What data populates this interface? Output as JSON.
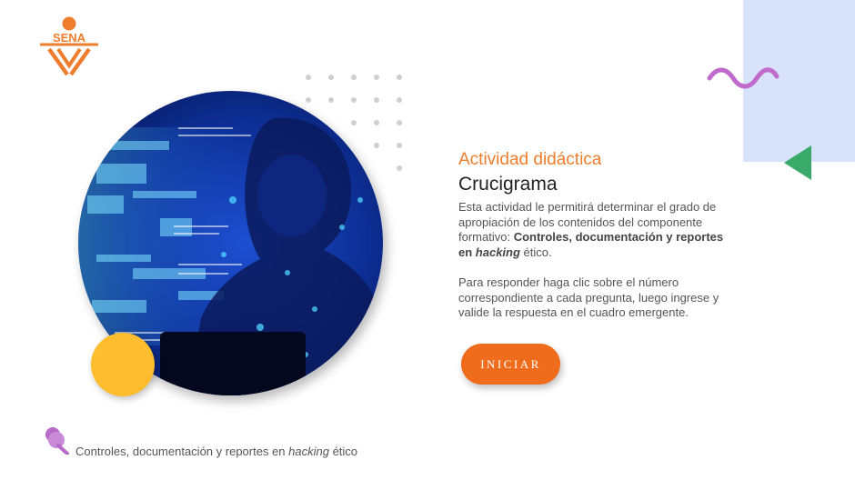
{
  "logo": {
    "text": "SENA",
    "color": "#ee7d2d"
  },
  "activity": {
    "subtitle": "Actividad didáctica",
    "title": "Crucigrama",
    "description_intro": "Esta actividad le permitirá determinar el grado de apropiación de los contenidos del componente formativo: ",
    "description_bold": "Controles, documentación y reportes en ",
    "description_bold_italic": "hacking",
    "description_end": " ético.",
    "instructions": "Para responder haga clic sobre el número correspondiente a cada pregunta, luego ingrese y valide la respuesta en el cuadro emergente."
  },
  "start_button": {
    "label": "INICIAR",
    "color": "#ee6c1c"
  },
  "footer": {
    "text_prefix": "Controles, documentación y reportes en ",
    "text_italic": "hacking",
    "text_suffix": " ético"
  },
  "colors": {
    "accent_orange": "#ee7d2d",
    "deco_blue": "#d8e2fb",
    "wave_purple": "#c06bcc",
    "triangle_green": "#3aaa6b",
    "circle_yellow": "#fdbd2f"
  },
  "icons": {
    "footer": "pin-bubble-icon",
    "decoration_wave": "wave-icon",
    "decoration_triangle": "triangle-icon"
  },
  "image": {
    "description": ""
  }
}
